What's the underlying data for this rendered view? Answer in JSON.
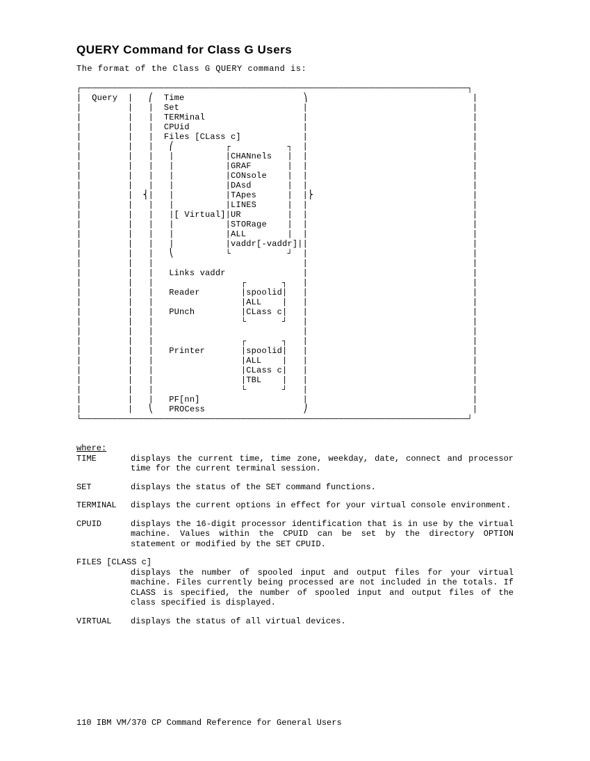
{
  "heading": "QUERY Command for Class G Users",
  "intro": "The format of the Class G QUERY command is:",
  "diagram": "┌───────────────────────────────────────────────────────────────────────────┐\n|  Query  |   ⎛  Time                       ⎞                                |\n|         |   |  Set                        |                                |\n|         |   |  TERMinal                   |                                |\n|         |   |  CPUid                      |                                |\n|         |   |  Files [CLass c]            |                                |\n|         |   |   ⎛          ┌           ┐  |                                |\n|         |   |   |          |CHANnels   |  |                                |\n|         |   |   |          |GRAF       |  |                                |\n|         |   |   |          |CONsole    |  |                                |\n|         |   |   |          |DAsd       |  |                                |\n|         |  ⎨|   |          |TApes      |  |⎬                               |\n|         |   |   |          |LINES      |  |                                |\n|         |   |   |[ Virtual]|UR         |  |                                |\n|         |   |   |          |STORage    |  |                                |\n|         |   |   |          |ALL        |  |                                |\n|         |   |   |          |vaddr[-vaddr]||                                |\n|         |   |   ⎝          └           ┘  |                                |\n|         |   |                             |                                |\n|         |   |   Links vaddr               |                                |\n|         |   |                 ┌       ┐   |                                |\n|         |   |   Reader        |spoolid|   |                                |\n|         |   |                 |ALL    |   |                                |\n|         |   |   PUnch         |CLass c|   |                                |\n|         |   |                 └       ┘   |                                |\n|         |   |                             |                                |\n|         |   |                 ┌       ┐   |                                |\n|         |   |   Printer       |spoolid|   |                                |\n|         |   |                 |ALL    |   |                                |\n|         |   |                 |CLass c|   |                                |\n|         |   |                 |TBL    |   |                                |\n|         |   |                 └       ┘   |                                |\n|         |   |   PF[nn]                    |                                |\n|         |   ⎝   PROCess                   ⎠                                |\n└───────────────────────────────────────────────────────────────────────────┘",
  "where_label": "where:",
  "definitions": [
    {
      "term": "TIME",
      "desc": "displays the current time, time zone, weekday, date, connect and processor time for the current terminal session."
    },
    {
      "term": "SET",
      "desc": "displays the status of the SET command functions."
    },
    {
      "term": "TERMINAL",
      "desc": "displays the current options in effect for your virtual console environment."
    },
    {
      "term": "CPUID",
      "desc": "displays the 16-digit processor identification that is in use by the virtual machine. Values within the CPUID can be set by the directory OPTION statement or modified by the SET CPUID."
    },
    {
      "term": "FILES [CLASS c]",
      "desc": "displays the number of spooled input and output files for your virtual machine. Files currently being processed are not included in the totals. If CLASS is specified, the number of spooled input and output files of the class specified is displayed.",
      "fullwidth_term": true
    },
    {
      "term": "VIRTUAL",
      "desc": "displays the status of all virtual devices."
    }
  ],
  "footer": "110   IBM VM/370 CP Command Reference for General Users"
}
